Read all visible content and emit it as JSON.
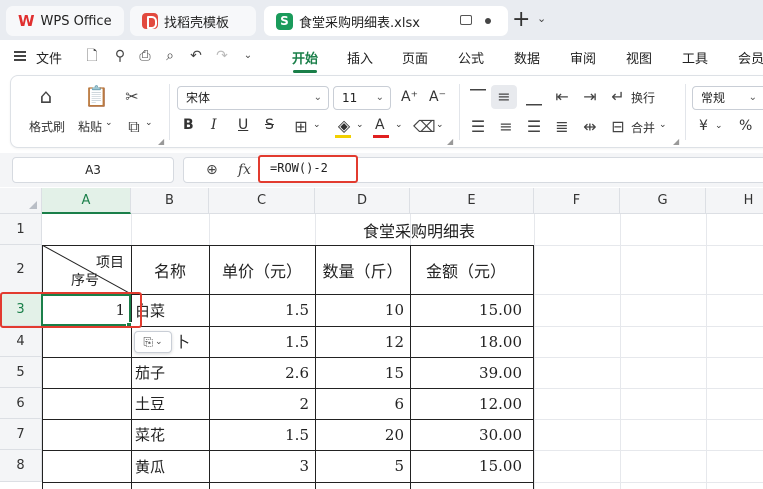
{
  "tabs": [
    {
      "label": "WPS Office",
      "icon": "wps-logo-icon"
    },
    {
      "label": "找稻壳模板",
      "icon": "docer-logo-icon"
    },
    {
      "label": "食堂采购明细表.xlsx",
      "icon": "spreadsheet-logo-icon",
      "active": true
    }
  ],
  "logos": {
    "wps": "W",
    "sheet": "S"
  },
  "menu": {
    "file": "文件",
    "tabs": [
      "开始",
      "插入",
      "页面",
      "公式",
      "数据",
      "审阅",
      "视图",
      "工具",
      "会员"
    ],
    "active_index": 0
  },
  "ribbon": {
    "format_painter": "格式刷",
    "paste": "粘贴",
    "font_name": "宋体",
    "font_size": "11",
    "wrap": "换行",
    "merge": "合并",
    "number_format": "常规",
    "currency_symbol": "¥",
    "percent_symbol": "%",
    "bold": "B",
    "italic": "I",
    "underline": "U",
    "strike": "S",
    "font_color_letter": "A",
    "grow_font": "A⁺",
    "shrink_font": "A⁻"
  },
  "formula_bar": {
    "name_box": "A3",
    "fx_label": "fx",
    "formula": "=ROW()-2"
  },
  "grid": {
    "columns": [
      "A",
      "B",
      "C",
      "D",
      "E",
      "F",
      "G",
      "H"
    ],
    "selected_column": "A",
    "rows": [
      "1",
      "2",
      "3",
      "4",
      "5",
      "6",
      "7",
      "8"
    ],
    "selected_row": "3",
    "table_title": "食堂采购明细表",
    "header": {
      "diag_top": "项目",
      "diag_bottom": "序号",
      "name": "名称",
      "price": "单价（元）",
      "qty": "数量（斤）",
      "amount": "金额（元）"
    },
    "data_rows": [
      {
        "seq": "1",
        "name": "白菜",
        "price": "1.5",
        "qty": "10",
        "amount": "15.00"
      },
      {
        "seq": "",
        "name": "卜",
        "price": "1.5",
        "qty": "12",
        "amount": "18.00"
      },
      {
        "seq": "",
        "name": "茄子",
        "price": "2.6",
        "qty": "15",
        "amount": "39.00"
      },
      {
        "seq": "",
        "name": "土豆",
        "price": "2",
        "qty": "6",
        "amount": "12.00"
      },
      {
        "seq": "",
        "name": "菜花",
        "price": "1.5",
        "qty": "20",
        "amount": "30.00"
      },
      {
        "seq": "",
        "name": "黄瓜",
        "price": "3",
        "qty": "5",
        "amount": "15.00"
      }
    ]
  },
  "colors": {
    "accent_green": "#1a7f49",
    "highlight_red": "#e23b2f"
  }
}
